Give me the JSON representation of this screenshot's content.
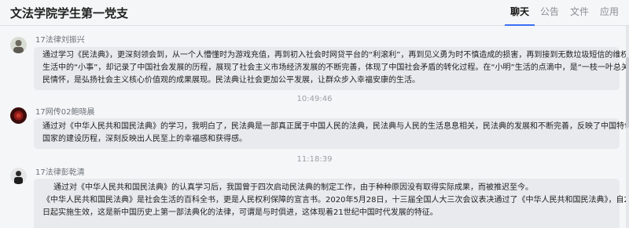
{
  "header": {
    "group_name": "文法学院学生第一党支",
    "tabs": [
      "聊天",
      "公告",
      "文件",
      "应用"
    ]
  },
  "messages": [
    {
      "sender": "17法律刘振兴",
      "lines": [
        "通过学习《民法典》，更深刻领会到，从一个人懵懂时为游戏充值，再到初入社会时网贷平台的“利滚利”，再到见义勇为时不慎造成的损害，再到接到无数垃圾短信的维权，这些看似",
        "生活中的“小事”，却记录了中国社会发展的历程，展现了社会主义市场经济发展的不断完善，体现了中国社会矛盾的转化过程。在“小明”生活的点滴中，是“一枝一叶总关情”的人",
        "民情怀，是弘扬社会主义核心价值观的成果展现。民法典让社会更加公平发展，让群众步入幸福安康的生活。"
      ]
    },
    {
      "time": "10:49:46",
      "sender": "17网传02鲍晓晨",
      "lines": [
        "通过对《中华人民共和国民法典》的学习，我明白了，民法典是一部真正属于中国人民的法典，民法典与人民的生活息息相关，民法典的发展和不断完善，反映了中国特色社会主义法治",
        "国家的建设历程，深刻反映出人民至上的幸福感和获得感。"
      ]
    },
    {
      "time": "11:18:39",
      "sender": "17法律彭乾清",
      "lines": [
        "通过对《中华人民共和国民法典》的认真学习后，我国曾于四次启动民法典的制定工作，由于种种原因没有取得实际成果，而被推迟至今。",
        "《中华人民共和国民法典》是社会生活的百科全书，更是人民权利保障的宣言书。2020年5月28日，十三届全国人大三次会议表决通过了《中华人民共和国民法典》，自2021年1月1",
        "日起实施生效，这是新中国历史上第一部法典化的法律，可谓是与时俱进，这体现着21世纪中国时代发展的特征。"
      ]
    }
  ]
}
